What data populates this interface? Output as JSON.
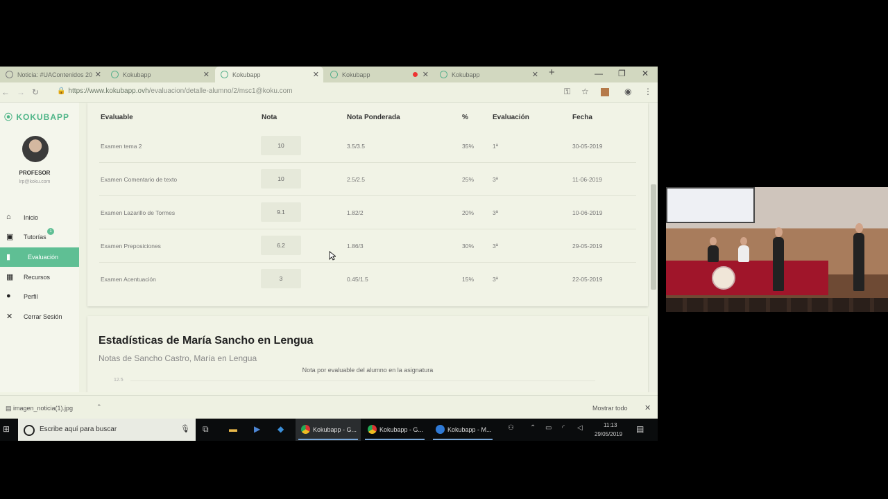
{
  "browser": {
    "tabs": [
      {
        "title": "Noticia: #UAContenidos 20",
        "active": false,
        "favicon": "globe-icon"
      },
      {
        "title": "Kokubapp",
        "active": false,
        "favicon": "kokubapp-icon"
      },
      {
        "title": "Kokubapp",
        "active": true,
        "favicon": "kokubapp-icon"
      },
      {
        "title": "Kokubapp",
        "active": false,
        "favicon": "kokubapp-icon",
        "recording": true
      },
      {
        "title": "Kokubapp",
        "active": false,
        "favicon": "kokubapp-icon"
      }
    ],
    "url_host": "https://www.kokubapp.ovh",
    "url_path": "/evaluacion/detalle-alumno/2/msc1@koku.com"
  },
  "sidebar": {
    "logo": "KOKUBAPP",
    "role": "PROFESOR",
    "email": "lrp@koku.com",
    "tutorias_badge": "1",
    "items": [
      {
        "label": "Inicio",
        "icon": "home-icon",
        "active": false
      },
      {
        "label": "Tutorías",
        "icon": "chat-icon",
        "active": false
      },
      {
        "label": "Evaluación",
        "icon": "book-icon",
        "active": true
      },
      {
        "label": "Recursos",
        "icon": "grid-icon",
        "active": false
      },
      {
        "label": "Perfil",
        "icon": "user-icon",
        "active": false
      },
      {
        "label": "Cerrar Sesión",
        "icon": "close-icon",
        "active": false
      }
    ]
  },
  "grades": {
    "headers": [
      "Evaluable",
      "Nota",
      "Nota Ponderada",
      "%",
      "Evaluación",
      "Fecha"
    ],
    "rows": [
      {
        "evaluable": "Examen tema 2",
        "nota": "10",
        "ponderada": "3.5/3.5",
        "pct": "35%",
        "evaluacion": "1ª",
        "fecha": "30-05-2019"
      },
      {
        "evaluable": "Examen Comentario de texto",
        "nota": "10",
        "ponderada": "2.5/2.5",
        "pct": "25%",
        "evaluacion": "3ª",
        "fecha": "11-06-2019"
      },
      {
        "evaluable": "Examen Lazarillo de Tormes",
        "nota": "9.1",
        "ponderada": "1.82/2",
        "pct": "20%",
        "evaluacion": "3ª",
        "fecha": "10-06-2019"
      },
      {
        "evaluable": "Examen Preposiciones",
        "nota": "6.2",
        "ponderada": "1.86/3",
        "pct": "30%",
        "evaluacion": "3ª",
        "fecha": "29-05-2019"
      },
      {
        "evaluable": "Examen Acentuación",
        "nota": "3",
        "ponderada": "0.45/1.5",
        "pct": "15%",
        "evaluacion": "3ª",
        "fecha": "22-05-2019"
      }
    ]
  },
  "stats": {
    "title": "Estadísticas de María Sancho en Lengua",
    "subtitle": "Notas de Sancho Castro, María en Lengua",
    "chart_title": "Nota por evaluable del alumno en la asignatura",
    "chart_top_tick": "12.5"
  },
  "download_bar": {
    "file": "imagen_noticia(1).jpg",
    "show_all": "Mostrar todo"
  },
  "taskbar": {
    "search_placeholder": "Escribe aquí para buscar",
    "apps": [
      {
        "label": "Kokubapp - G...",
        "icon": "chrome-icon",
        "active": true
      },
      {
        "label": "Kokubapp - G...",
        "icon": "chrome-icon",
        "active": false
      },
      {
        "label": "Kokubapp - M...",
        "icon": "edge-icon",
        "active": false
      }
    ],
    "time": "11:13",
    "date": "29/05/2019"
  },
  "colors": {
    "accent": "#5fbf94",
    "recording": "#e33333",
    "edge": "#2f7ad6"
  }
}
